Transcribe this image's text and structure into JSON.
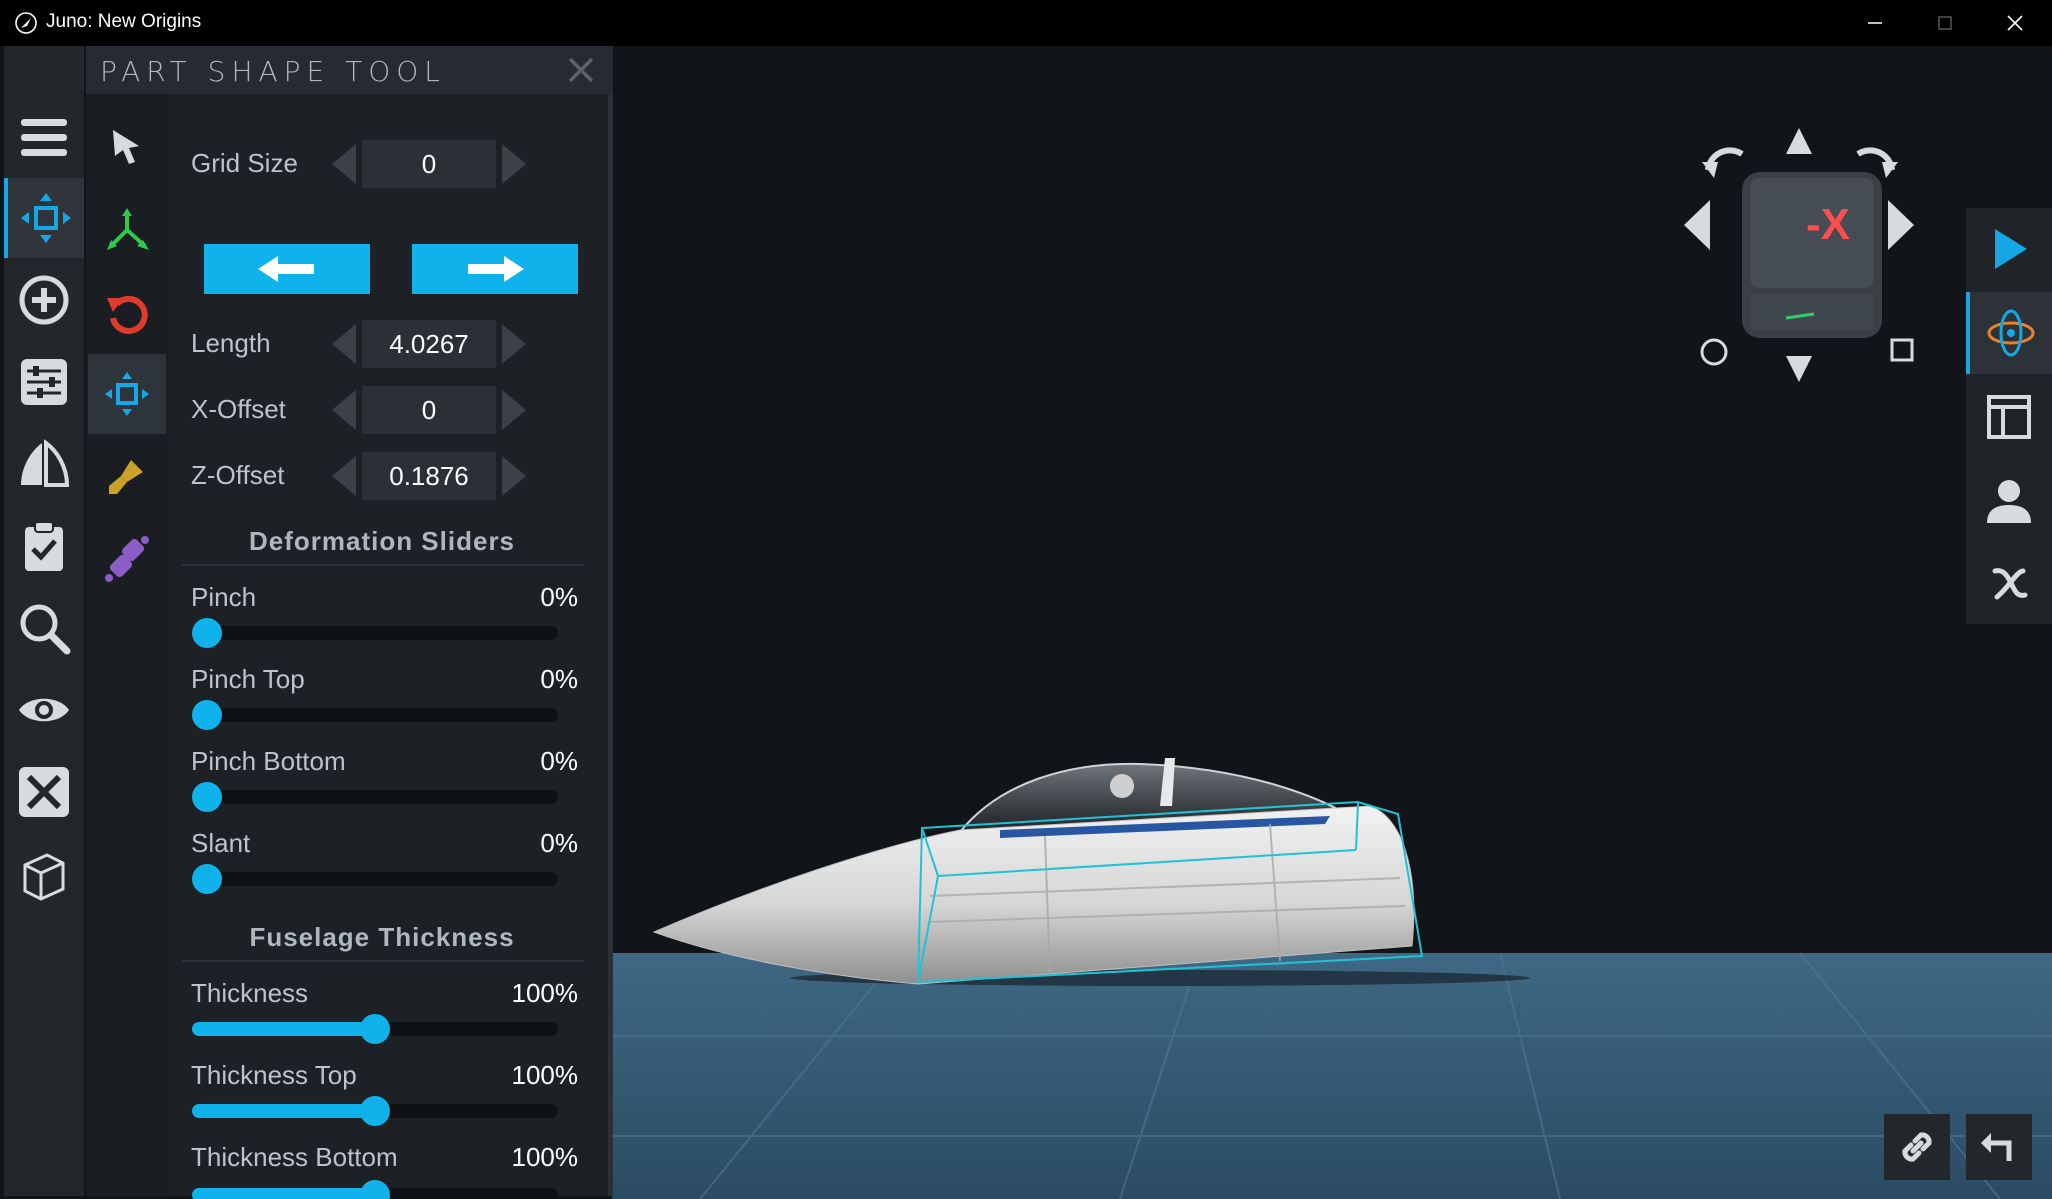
{
  "window": {
    "title": "Juno: New Origins",
    "icons": [
      "app-icon",
      "minimize-icon",
      "maximize-icon",
      "close-icon"
    ]
  },
  "left_toolbar": {
    "items": [
      {
        "name": "menu",
        "icon": "hamburger-icon"
      },
      {
        "name": "move",
        "icon": "move-arrows-icon",
        "active": true
      },
      {
        "name": "add-part",
        "icon": "plus-circle-icon"
      },
      {
        "name": "properties",
        "icon": "sliders-icon"
      },
      {
        "name": "symmetry",
        "icon": "symmetry-icon"
      },
      {
        "name": "checklist",
        "icon": "clipboard-check-icon"
      },
      {
        "name": "search",
        "icon": "search-icon"
      },
      {
        "name": "view",
        "icon": "eye-icon"
      },
      {
        "name": "tools",
        "icon": "wrench-screwdriver-icon"
      },
      {
        "name": "view-3d",
        "icon": "cube-outline-icon"
      }
    ]
  },
  "tool_panel": {
    "title": "PART SHAPE TOOL",
    "sub_tools": [
      {
        "name": "select",
        "icon": "cursor-arrow-icon"
      },
      {
        "name": "translate",
        "icon": "axis-gizmo-icon"
      },
      {
        "name": "rotate",
        "icon": "rotate-icon"
      },
      {
        "name": "shape",
        "icon": "move-arrows-icon",
        "active": true
      },
      {
        "name": "paint",
        "icon": "paintbrush-icon"
      },
      {
        "name": "connect",
        "icon": "connector-icon"
      }
    ],
    "grid_size": {
      "label": "Grid Size",
      "value": "0"
    },
    "length": {
      "label": "Length",
      "value": "4.0267"
    },
    "x_offset": {
      "label": "X-Offset",
      "value": "0"
    },
    "z_offset": {
      "label": "Z-Offset",
      "value": "0.1876"
    },
    "deformation": {
      "title": "Deformation Sliders",
      "sliders": [
        {
          "label": "Pinch",
          "value": "0%",
          "fraction": 0.0
        },
        {
          "label": "Pinch Top",
          "value": "0%",
          "fraction": 0.0
        },
        {
          "label": "Pinch Bottom",
          "value": "0%",
          "fraction": 0.0
        },
        {
          "label": "Slant",
          "value": "0%",
          "fraction": 0.0
        }
      ]
    },
    "thickness": {
      "title": "Fuselage Thickness",
      "sliders": [
        {
          "label": "Thickness",
          "value": "100%",
          "fraction": 0.5
        },
        {
          "label": "Thickness Top",
          "value": "100%",
          "fraction": 0.5
        },
        {
          "label": "Thickness Bottom",
          "value": "100%",
          "fraction": 0.5
        }
      ]
    }
  },
  "view_cube": {
    "label": "-X"
  },
  "right_toolbar": {
    "items": [
      {
        "name": "play",
        "icon": "play-icon"
      },
      {
        "name": "orbit",
        "icon": "orbit-icon",
        "active": true
      },
      {
        "name": "layout",
        "icon": "panel-layout-icon"
      },
      {
        "name": "crew",
        "icon": "person-icon"
      },
      {
        "name": "variables",
        "icon": "variable-x-icon"
      }
    ]
  },
  "bottom_right": {
    "icons": [
      "link-icon",
      "undo-icon"
    ]
  },
  "colors": {
    "accent": "#0fb2ea",
    "panel": "#1d2126",
    "viewport": "#111418",
    "water": "#385a75",
    "cube_label": "#ff4d4d"
  }
}
